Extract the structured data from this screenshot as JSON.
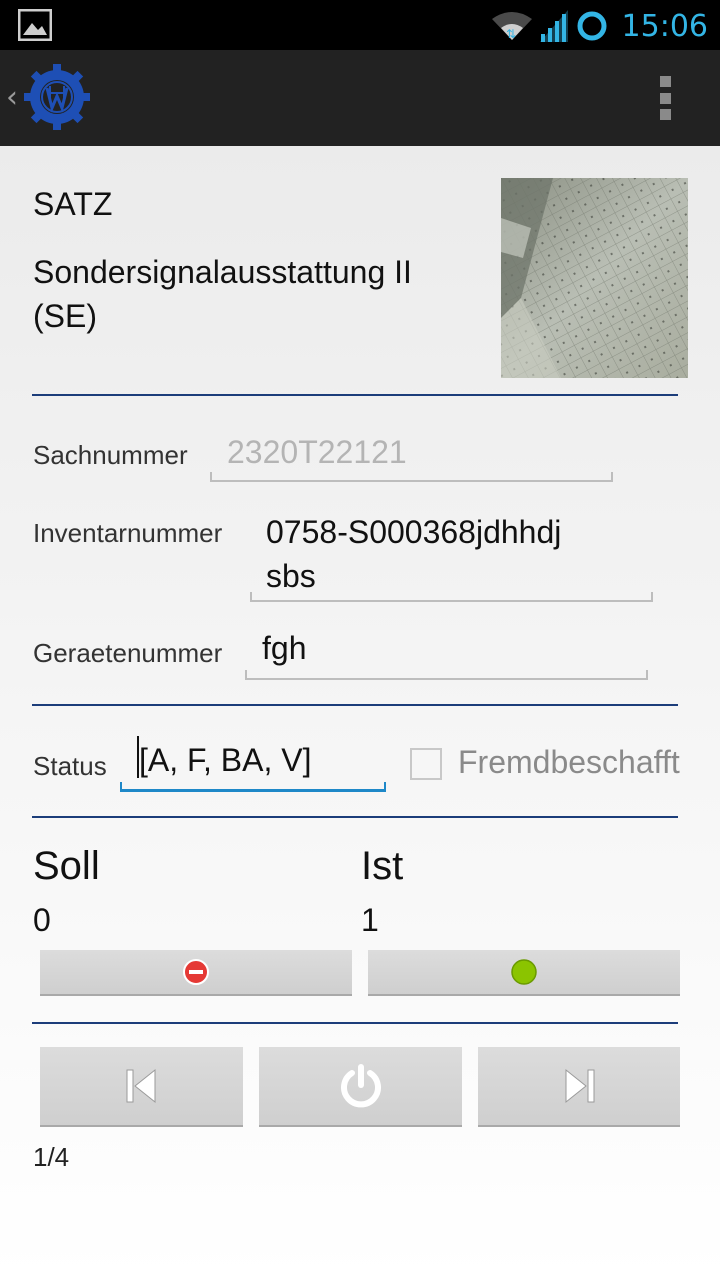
{
  "statusbar": {
    "time": "15:06"
  },
  "header": {
    "satz_label": "SATZ",
    "satz_name": "Sondersignalausstattung II (SE)"
  },
  "fields": {
    "sachnummer": {
      "label": "Sachnummer",
      "value": "2320T22121"
    },
    "inventarnummer": {
      "label": "Inventarnummer",
      "value": "0758-S000368jdhhdjsbs"
    },
    "geraetenummer": {
      "label": "Geraetenummer",
      "value": "fgh"
    },
    "status": {
      "label": "Status",
      "value": "[A, F, BA, V]"
    },
    "fremdbeschafft": {
      "label": "Fremdbeschafft",
      "checked": false
    }
  },
  "counts": {
    "soll": {
      "label": "Soll",
      "value": "0"
    },
    "ist": {
      "label": "Ist",
      "value": "1"
    }
  },
  "pager": {
    "text": "1/4"
  },
  "colors": {
    "accent_divider": "#1c3d7a",
    "focus": "#1e88c8",
    "statusbar_accent": "#33b5e5",
    "minus": "#e53935",
    "ok": "#8bc400"
  },
  "icons": [
    "gallery-icon",
    "wifi-icon",
    "signal-icon",
    "sync-icon",
    "app-logo-icon",
    "overflow-menu-icon",
    "minus-circle-icon",
    "green-dot-icon",
    "skip-previous-icon",
    "power-icon",
    "skip-next-icon"
  ]
}
